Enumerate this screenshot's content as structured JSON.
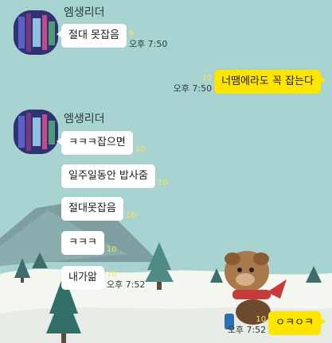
{
  "colors": {
    "background": "#a7d3d0",
    "my_bubble": "#fee500",
    "their_bubble": "#ffffff",
    "unread": "#ffe34d"
  },
  "background_icons": [
    "mountain-icon",
    "pine-tree-icon",
    "snow-ground-icon",
    "dog-character-icon"
  ],
  "group1": {
    "sender": "엠생리더",
    "messages": [
      {
        "text": "절대 못잡음",
        "unread": "9",
        "time": "오후 7:50"
      }
    ]
  },
  "mine": {
    "text": "너땜에라도 꼭 잡는다",
    "unread": "10",
    "time": "오후 7:50"
  },
  "group2": {
    "sender": "엠생리더",
    "messages": [
      {
        "text": "ㅋㅋㅋ잡으면",
        "unread": "10"
      },
      {
        "text": "일주일동안 밥사줌",
        "unread": "10"
      },
      {
        "text": "절대못잡음",
        "unread": "10"
      },
      {
        "text": "ㅋㅋㅋ",
        "unread": "10"
      },
      {
        "text": "내가앎",
        "unread": "10",
        "time": "오후 7:52"
      }
    ]
  },
  "mine2": {
    "text": "ㅇㅋㅇㅋ",
    "unread": "10",
    "time": "오후 7:52"
  }
}
